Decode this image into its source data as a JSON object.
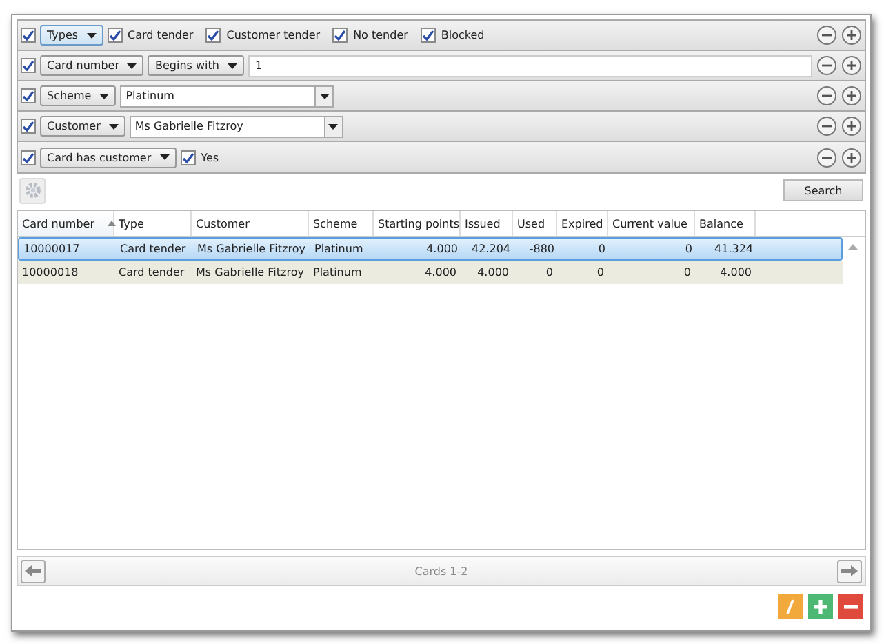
{
  "filters": [
    {
      "kind": "types",
      "enabled": true,
      "field": "Types",
      "options": [
        {
          "label": "Card tender",
          "checked": true
        },
        {
          "label": "Customer tender",
          "checked": true
        },
        {
          "label": "No tender",
          "checked": true
        },
        {
          "label": "Blocked",
          "checked": true
        }
      ]
    },
    {
      "kind": "text",
      "enabled": true,
      "field": "Card number",
      "operator": "Begins with",
      "value": "1"
    },
    {
      "kind": "combo",
      "enabled": true,
      "field": "Scheme",
      "value": "Platinum"
    },
    {
      "kind": "combo",
      "enabled": true,
      "field": "Customer",
      "value": "Ms Gabrielle Fitzroy"
    },
    {
      "kind": "bool",
      "enabled": true,
      "field": "Card has customer",
      "options": [
        {
          "label": "Yes",
          "checked": true
        }
      ]
    }
  ],
  "search_button": "Search",
  "table": {
    "columns": [
      {
        "label": "Card number",
        "sorted": true
      },
      {
        "label": "Type",
        "sorted": false
      },
      {
        "label": "Customer",
        "sorted": false
      },
      {
        "label": "Scheme",
        "sorted": false
      },
      {
        "label": "Starting points",
        "sorted": false
      },
      {
        "label": "Issued",
        "sorted": false
      },
      {
        "label": "Used",
        "sorted": false
      },
      {
        "label": "Expired",
        "sorted": false
      },
      {
        "label": "Current value",
        "sorted": false
      },
      {
        "label": "Balance",
        "sorted": false
      }
    ],
    "rows": [
      {
        "selected": true,
        "cells": [
          "10000017",
          "Card tender",
          "Ms Gabrielle Fitzroy",
          "Platinum",
          "4.000",
          "42.204",
          "-880",
          "0",
          "0",
          "41.324"
        ]
      },
      {
        "selected": false,
        "cells": [
          "10000018",
          "Card tender",
          "Ms Gabrielle Fitzroy",
          "Platinum",
          "4.000",
          "4.000",
          "0",
          "0",
          "0",
          "4.000"
        ]
      }
    ]
  },
  "pager": {
    "label": "Cards 1-2"
  }
}
